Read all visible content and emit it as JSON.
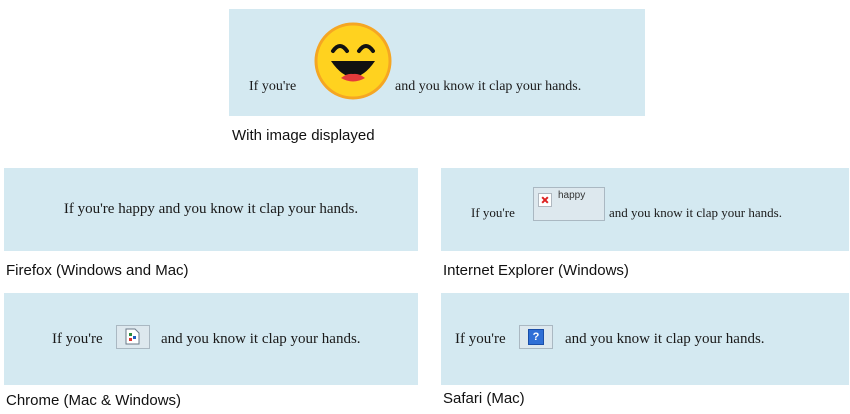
{
  "sentence": {
    "before": "If you're",
    "word": "happy",
    "after": "and you know it clap your hands.",
    "full": "If you're happy and you know it clap your hands."
  },
  "captions": {
    "main": "With image displayed",
    "firefox": "Firefox (Windows and Mac)",
    "ie": "Internet Explorer (Windows)",
    "chrome": "Chrome (Mac & Windows)",
    "safari": "Safari (Mac)"
  },
  "icons": {
    "smiley": "laughing-smiley-icon",
    "ie_broken": "red-x-broken-image-icon",
    "chrome_broken": "broken-page-icon",
    "safari_broken": "question-mark-icon"
  },
  "colors": {
    "panel_bg": "#d4e9f1",
    "smiley_face": "#ffd21f",
    "smiley_outline": "#f0a020"
  }
}
